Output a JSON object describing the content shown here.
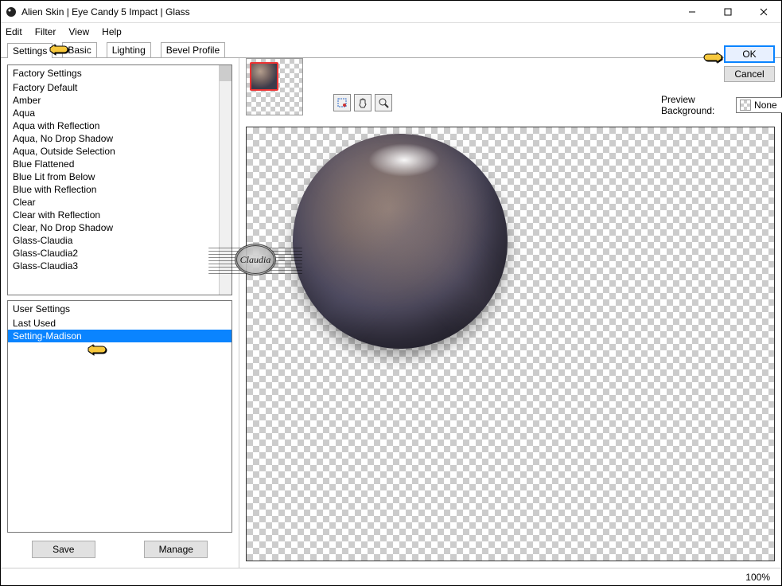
{
  "window": {
    "title": "Alien Skin | Eye Candy 5 Impact | Glass"
  },
  "menubar": [
    "Edit",
    "Filter",
    "View",
    "Help"
  ],
  "tabs": [
    "Settings",
    "Basic",
    "Lighting",
    "Bevel Profile"
  ],
  "active_tab": 0,
  "factory": {
    "header": "Factory Settings",
    "items": [
      "Factory Default",
      "Amber",
      "Aqua",
      "Aqua with Reflection",
      "Aqua, No Drop Shadow",
      "Aqua, Outside Selection",
      "Blue Flattened",
      "Blue Lit from Below",
      "Blue with Reflection",
      "Clear",
      "Clear with Reflection",
      "Clear, No Drop Shadow",
      "Glass-Claudia",
      "Glass-Claudia2",
      "Glass-Claudia3"
    ]
  },
  "user": {
    "header": "User Settings",
    "items": [
      "Last Used",
      "Setting-Madison"
    ],
    "selected_index": 1
  },
  "buttons": {
    "save": "Save",
    "manage": "Manage",
    "ok": "OK",
    "cancel": "Cancel"
  },
  "preview_bg": {
    "label": "Preview Background:",
    "value": "None"
  },
  "status": {
    "zoom": "100%"
  },
  "watermark": "Claudia"
}
